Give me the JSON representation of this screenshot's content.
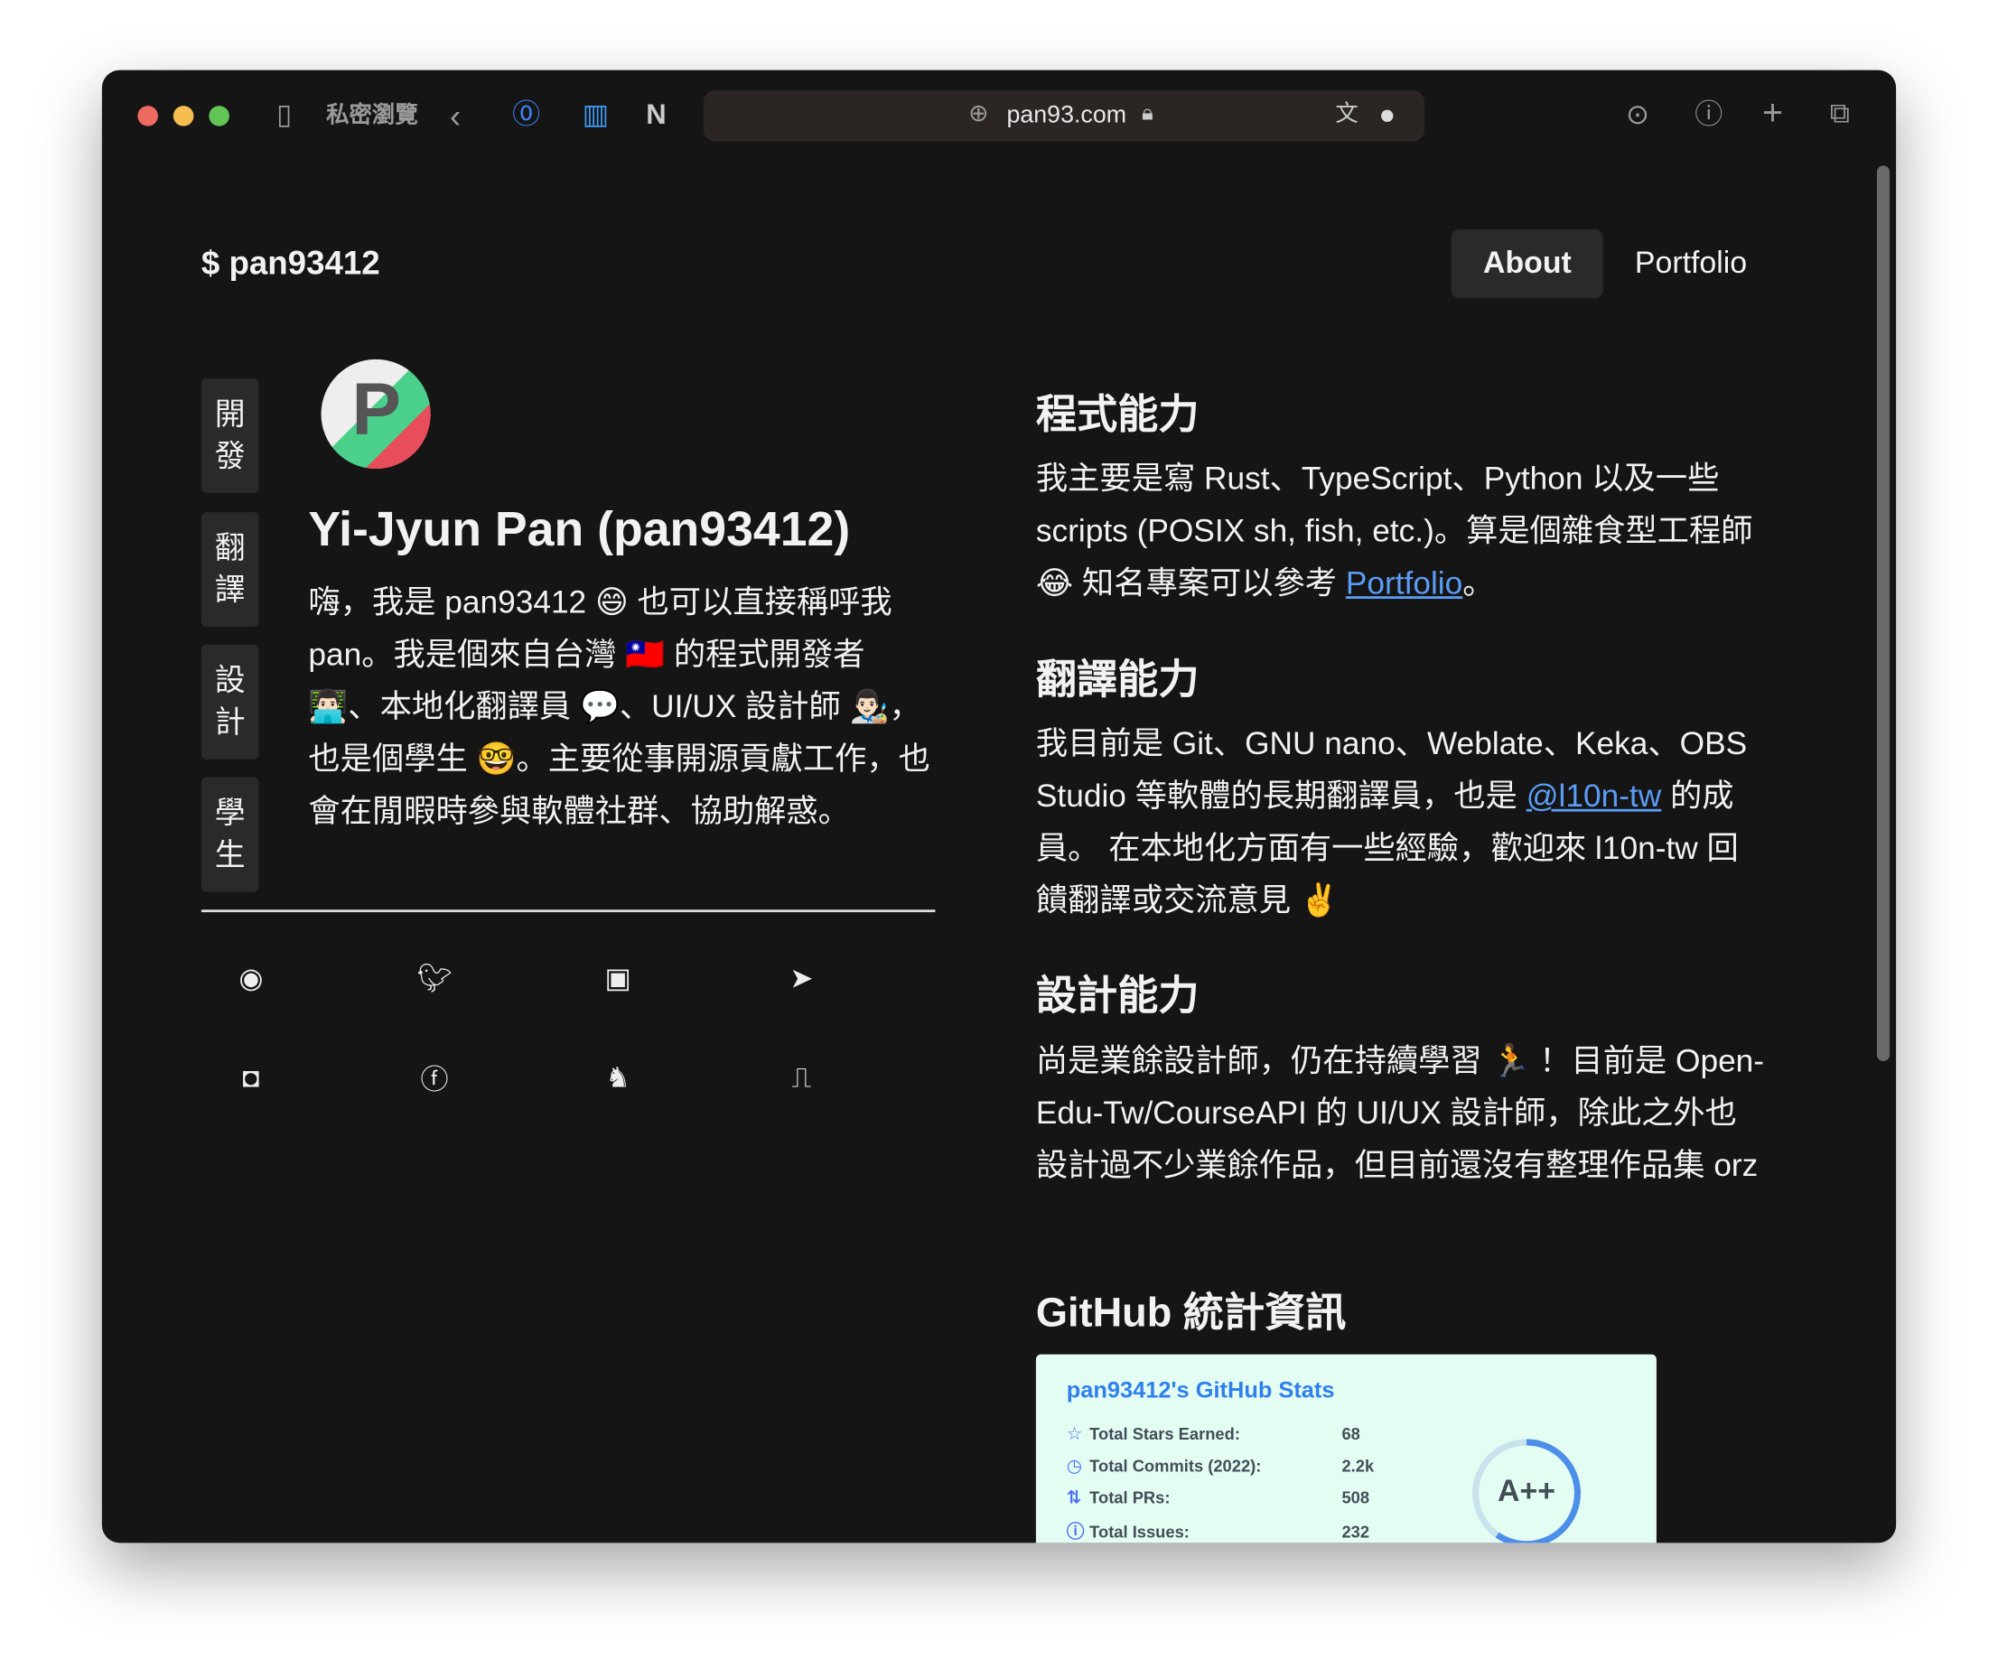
{
  "browser": {
    "private_label": "私密瀏覽",
    "url": "pan93.com",
    "traffic_colors": [
      "#ee6a5f",
      "#f5be4f",
      "#62c555"
    ]
  },
  "site": {
    "logo": "$ pan93412",
    "nav": [
      {
        "label": "About",
        "active": true
      },
      {
        "label": "Portfolio",
        "active": false
      }
    ]
  },
  "sidebar": {
    "tabs": [
      "開\n發",
      "翻\n譯",
      "設\n計",
      "學\n生"
    ]
  },
  "profile": {
    "name": "Yi-Jyun Pan (pan93412)",
    "bio": "嗨，我是 pan93412 😄 也可以直接稱呼我 pan。我是個來自台灣 🇹🇼 的程式開發者 👨🏻‍💻、本地化翻譯員 💬、UI/UX 設計師 👨🏻‍🎨，也是個學生 🤓。主要從事開源貢獻工作，也會在閒暇時參與軟體社群、協助解惑。"
  },
  "social_icons": [
    "github-icon",
    "twitter-icon",
    "blogger-icon",
    "telegram-icon",
    "discord-icon",
    "facebook-icon",
    "mastodon-icon",
    "mailbox-icon"
  ],
  "sections": {
    "coding": {
      "title": "程式能力",
      "text1": "我主要是寫 Rust、TypeScript、Python 以及一些 scripts (POSIX sh, fish, etc.)。算是個雜食型工程師 😂 知名專案可以參考 ",
      "link": "Portfolio",
      "text2": "。"
    },
    "translation": {
      "title": "翻譯能力",
      "text1": "我目前是 Git、GNU nano、Weblate、Keka、OBS Studio 等軟體的長期翻譯員，也是 ",
      "link": "@l10n-tw",
      "text2": " 的成員。 在本地化方面有一些經驗，歡迎來 l10n-tw 回饋翻譯或交流意見 ✌️"
    },
    "design": {
      "title": "設計能力",
      "text": "尚是業餘設計師，仍在持續學習 🏃 ！目前是 Open-Edu-Tw/CourseAPI 的 UI/UX 設計師，除此之外也設計過不少業餘作品，但目前還沒有整理作品集 orz"
    },
    "github": {
      "title": "GitHub 統計資訊"
    }
  },
  "stats": {
    "title": "pan93412's GitHub Stats",
    "rows": [
      {
        "label": "Total Stars Earned:",
        "value": "68",
        "icon": "☆"
      },
      {
        "label": "Total Commits (2022):",
        "value": "2.2k",
        "icon": "◷"
      },
      {
        "label": "Total PRs:",
        "value": "508",
        "icon": "⇅"
      },
      {
        "label": "Total Issues:",
        "value": "232",
        "icon": "ⓘ"
      }
    ],
    "rank": "A++"
  }
}
